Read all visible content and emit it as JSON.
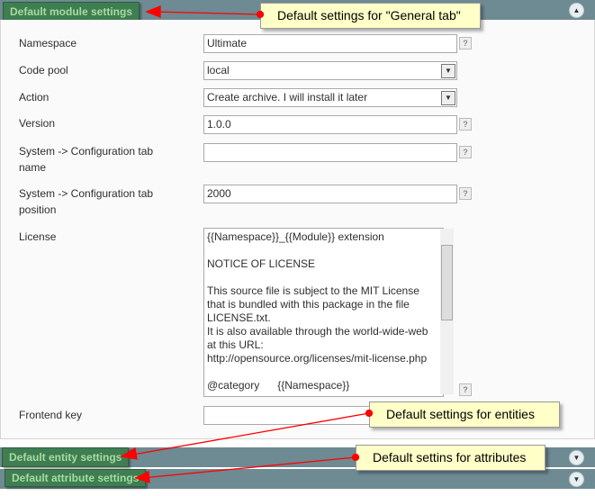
{
  "sections": [
    {
      "title": "Default module settings",
      "state": "expanded"
    },
    {
      "title": "Default entity settings",
      "state": "collapsed"
    },
    {
      "title": "Default attribute settings",
      "state": "collapsed"
    }
  ],
  "fields": {
    "namespace": {
      "label": "Namespace",
      "value": "Ultimate"
    },
    "code_pool": {
      "label": "Code pool",
      "value": "local"
    },
    "action": {
      "label": "Action",
      "value": "Create archive. I will install it later"
    },
    "version": {
      "label": "Version",
      "value": "1.0.0"
    },
    "config_tab_name": {
      "label_1": "System -> Configuration tab",
      "label_2": "name",
      "value": ""
    },
    "config_tab_position": {
      "label_1": "System -> Configuration tab",
      "label_2": "position",
      "value": "2000"
    },
    "license": {
      "label": "License",
      "value": "{{Namespace}}_{{Module}} extension\n\nNOTICE OF LICENSE\n\nThis source file is subject to the MIT License\nthat is bundled with this package in the file\nLICENSE.txt.\nIt is also available through the world-wide-web\nat this URL:\nhttp://opensource.org/licenses/mit-license.php\n\n@category      {{Namespace}}"
    },
    "frontend_key": {
      "label": "Frontend key",
      "value": ""
    }
  },
  "help_glyph": "?",
  "callouts": [
    "Default settings for \"General tab\"",
    "Default settings for entities",
    "Default settins for attributes"
  ],
  "colors": {
    "bar": "#6e8a93",
    "tag": "#3f7e52",
    "tag_text": "#a8dba0",
    "callout": "#ffffc8",
    "arrow": "#ff0000"
  }
}
